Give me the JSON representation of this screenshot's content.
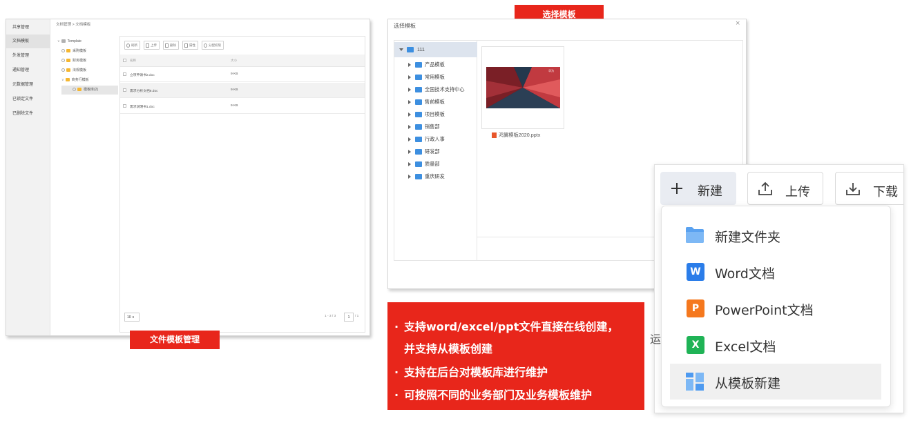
{
  "panel1": {
    "sidebar": [
      "共享管理",
      "文档模板",
      "外发管理",
      "通知管理",
      "元数据管理",
      "已锁定文件",
      "已删除文件"
    ],
    "breadcrumb": "文档管理 > 文档模板",
    "tree": {
      "root": "Template",
      "children": [
        "采购模板",
        "财务模板",
        "法规模板",
        "商务行模板"
      ],
      "grandchild": "模板库(2)"
    },
    "toolbar": [
      "刷新",
      "上传",
      "删除",
      "属性",
      "分配权限"
    ],
    "columns": {
      "name": "名称",
      "size": "大小"
    },
    "rows": [
      {
        "name": "立项申请书2.doc",
        "size": "9 KB"
      },
      {
        "name": "需求分析文档8.doc",
        "size": "9 KB"
      },
      {
        "name": "需求说明书1.doc",
        "size": "9 KB"
      }
    ],
    "pager": {
      "page_size": "10",
      "range": "1 - 3 / 3",
      "page": "1",
      "total": "/ 1"
    }
  },
  "label1": "文件模板管理",
  "label2": "选择模板",
  "panel2": {
    "title": "选择模板",
    "close": "×",
    "root": "111",
    "folders": [
      "产品模板",
      "常用模板",
      "全国技术支持中心",
      "售前模板",
      "项目模板",
      "销售部",
      "行政人事",
      "研发部",
      "质量部",
      "重庆研发"
    ],
    "thumb_tag": "华为",
    "file": "鸿翼模板2020.pptx"
  },
  "info": {
    "bullets": [
      "支持word/excel/ppt文件直接在线创建，",
      "并支持从模板创建",
      "支持在后台对模板库进行维护",
      "可按照不同的业务部门及业务模板维护"
    ],
    "bullet_char": "·"
  },
  "panel3": {
    "buttons": {
      "new": "新建",
      "upload": "上传",
      "download": "下载"
    },
    "menu": [
      {
        "label": "新建文件夹",
        "icon": "folder-icon",
        "glyph": ""
      },
      {
        "label": "Word文档",
        "icon": "word-icon",
        "glyph": "W",
        "color": "#2b7de9"
      },
      {
        "label": "PowerPoint文档",
        "icon": "powerpoint-icon",
        "glyph": "P",
        "color": "#f5781e"
      },
      {
        "label": "Excel文档",
        "icon": "excel-icon",
        "glyph": "X",
        "color": "#1fb356"
      },
      {
        "label": "从模板新建",
        "icon": "template-icon",
        "glyph": ""
      }
    ],
    "edge_text": "运"
  },
  "colors": {
    "accent_red": "#e8261b",
    "folder_blue": "#3d8fe0",
    "folder_yellow": "#f5b731"
  }
}
